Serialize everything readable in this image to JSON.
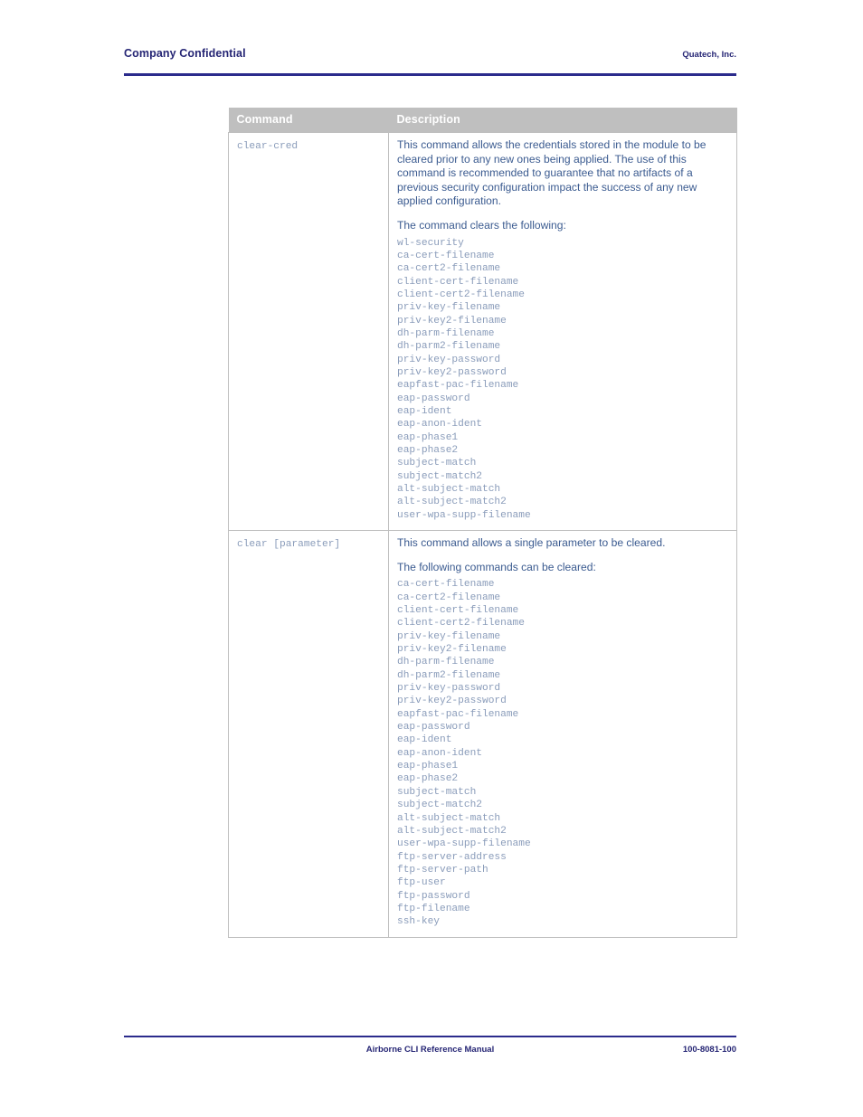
{
  "header": {
    "left_label": "Company Confidential",
    "right_label": "Quatech, Inc."
  },
  "footer": {
    "center_label": "Airborne CLI Reference Manual",
    "right_label": "100-8081-100"
  },
  "colors": {
    "header_rule": "#2b2b8c",
    "header_text": "#262675",
    "table_header_bg": "#bfbfbf",
    "table_header_text": "#ffffff",
    "table_border": "#bfbfbf",
    "body_text": "#3b5b90",
    "code_text": "#8a9cba"
  },
  "table": {
    "columns": [
      "Command",
      "Description"
    ],
    "rows": [
      {
        "command": "clear-cred",
        "paragraph_1": "This command allows the credentials stored in the module to be cleared prior to any new ones being applied. The use of this command is recommended to guarantee that no artifacts of a previous security configuration impact the success of any new applied configuration.",
        "paragraph_2": "The command clears the following:",
        "items": [
          "wl-security",
          "ca-cert-filename",
          "ca-cert2-filename",
          "client-cert-filename",
          "client-cert2-filename",
          "priv-key-filename",
          "priv-key2-filename",
          "dh-parm-filename",
          "dh-parm2-filename",
          "priv-key-password",
          "priv-key2-password",
          "eapfast-pac-filename",
          "eap-password",
          "eap-ident",
          "eap-anon-ident",
          "eap-phase1",
          "eap-phase2",
          "subject-match",
          "subject-match2",
          "alt-subject-match",
          "alt-subject-match2",
          "user-wpa-supp-filename"
        ]
      },
      {
        "command": "clear [parameter]",
        "paragraph_1": "This command allows a single parameter to be cleared.",
        "paragraph_2": "The following commands can be cleared:",
        "items": [
          "ca-cert-filename",
          "ca-cert2-filename",
          "client-cert-filename",
          "client-cert2-filename",
          "priv-key-filename",
          "priv-key2-filename",
          "dh-parm-filename",
          "dh-parm2-filename",
          "priv-key-password",
          "priv-key2-password",
          "eapfast-pac-filename",
          "eap-password",
          "eap-ident",
          "eap-anon-ident",
          "eap-phase1",
          "eap-phase2",
          "subject-match",
          "subject-match2",
          "alt-subject-match",
          "alt-subject-match2",
          "user-wpa-supp-filename",
          "ftp-server-address",
          "ftp-server-path",
          "ftp-user",
          "ftp-password",
          "ftp-filename",
          "ssh-key"
        ]
      }
    ]
  }
}
